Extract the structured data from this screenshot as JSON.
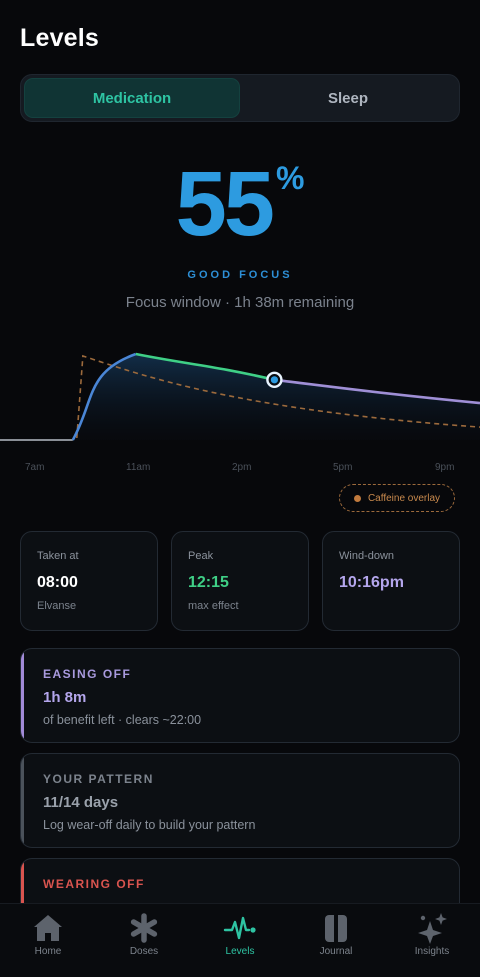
{
  "header": {
    "title": "Levels"
  },
  "segment": {
    "active": "Medication",
    "inactive": "Sleep"
  },
  "focus": {
    "value": "55",
    "unit": "%",
    "label": "GOOD FOCUS",
    "subtitle": "Focus window · 1h 38m remaining"
  },
  "chart_data": {
    "type": "area",
    "x_ticks": [
      "7am",
      "11am",
      "2pm",
      "5pm",
      "9pm"
    ],
    "series": [
      {
        "values_hours": [
          6,
          8.5,
          11,
          14,
          16.5,
          18,
          21.5
        ],
        "levels": [
          0,
          0,
          100,
          85,
          70,
          62,
          43
        ]
      }
    ],
    "overlay": {
      "label": "Caffeine overlay",
      "color": "#c17a3d"
    },
    "current_marker_hour": 16.5,
    "colors": {
      "rise": "#4a86d6",
      "peak": "#3fcf86",
      "wind_down": "#9f8fd6",
      "marker": "#2d9be0"
    }
  },
  "stats": [
    {
      "label": "Taken at",
      "value": "08:00",
      "sub": "Elvanse",
      "color": "#ffffff"
    },
    {
      "label": "Peak",
      "value": "12:15",
      "sub": "max effect",
      "color": "#3fcf86"
    },
    {
      "label": "Wind-down",
      "value": "10:16pm",
      "sub": "",
      "color": "#b4a6ec"
    }
  ],
  "cards": [
    {
      "key": "EASING OFF",
      "value": "1h 8m",
      "sub": "of benefit left · clears ~22:00",
      "accent": "#a28bd8",
      "value_color": "#b4a6ec"
    },
    {
      "key": "YOUR PATTERN",
      "value": "11/14 days",
      "sub": "Log wear-off daily to build your pattern",
      "accent": "#4b525b",
      "value_color": "#9aa1ab"
    },
    {
      "key": "WEARING OFF",
      "value": "",
      "sub": "",
      "accent": "#d9544f",
      "value_color": "#d9544f"
    }
  ],
  "nav": [
    {
      "label": "Home",
      "icon": "home-icon"
    },
    {
      "label": "Doses",
      "icon": "asterisk-icon"
    },
    {
      "label": "Levels",
      "icon": "pulse-icon",
      "active": true
    },
    {
      "label": "Journal",
      "icon": "journal-icon"
    },
    {
      "label": "Insights",
      "icon": "sparkle-icon"
    }
  ]
}
